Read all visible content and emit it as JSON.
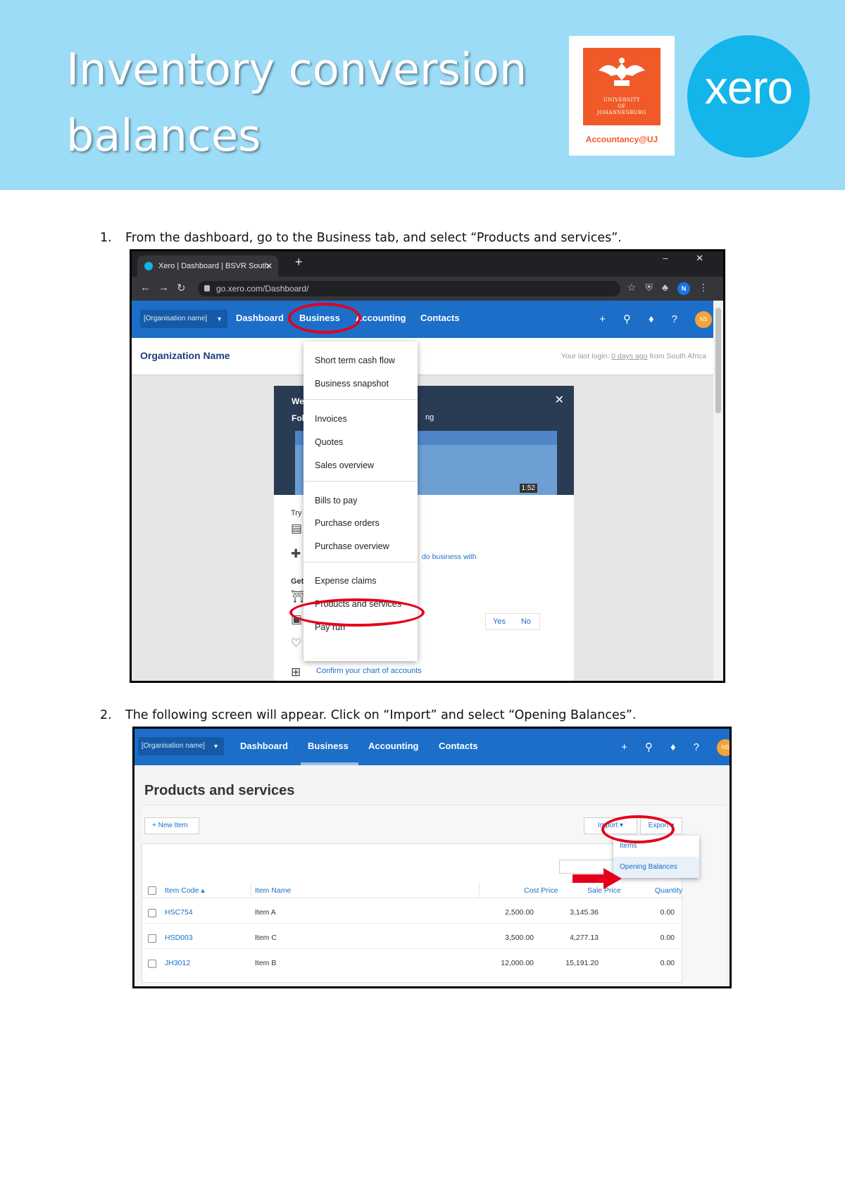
{
  "header": {
    "title_line1": "Inventory conversion",
    "title_line2": "balances",
    "uj_logo": {
      "name_line1": "UNIVERSITY",
      "name_line2": "OF",
      "name_line3": "JOHANNESBURG",
      "caption": "Accountancy@UJ",
      "color": "#f05a28"
    },
    "xero_logo": {
      "word": "xero",
      "color": "#13b5ea"
    },
    "banner_color": "#9ddcf6"
  },
  "steps": [
    {
      "number": "1.",
      "text": "From the dashboard, go to the Business tab, and select “Products and services”."
    },
    {
      "number": "2.",
      "text": "The following screen will appear. Click on “Import” and select “Opening Balances”."
    }
  ],
  "screenshot1": {
    "browser": {
      "tab_title": "Xero | Dashboard | BSVR South …",
      "tab_close": "✕",
      "new_tab": "+",
      "window_controls": "– ✕",
      "url": "go.xero.com/Dashboard/",
      "profile_initial": "N"
    },
    "nav": {
      "org_selector": "[Organisation name]",
      "links": [
        "Dashboard",
        "Business",
        "Accounting",
        "Contacts"
      ],
      "avatar": "NS"
    },
    "org_name": "Organization Name",
    "last_login_prefix": "Your last login: ",
    "last_login_link": "0 days ago",
    "last_login_suffix": " from South Africa",
    "modal": {
      "title_partial": "We",
      "subtitle_partial": "Fol",
      "subtitle_right": "ng",
      "video_duration": "1:52",
      "try_partial": "Try",
      "get_partial": "Get",
      "do_business": "do business with",
      "yes": "Yes",
      "no": "No",
      "confirm_link": "Confirm your chart of accounts"
    },
    "business_menu": [
      "Short term cash flow",
      "Business snapshot",
      "Invoices",
      "Quotes",
      "Sales overview",
      "Bills to pay",
      "Purchase orders",
      "Purchase overview",
      "Expense claims",
      "Products and services",
      "Pay run"
    ]
  },
  "screenshot2": {
    "nav": {
      "org_selector": "[Organisation name]",
      "links": [
        "Dashboard",
        "Business",
        "Accounting",
        "Contacts"
      ],
      "avatar": "NS"
    },
    "page_title": "Products and services",
    "new_item_button": "+ New Item",
    "import_button": "Import ▾",
    "export_button": "Export ▾",
    "import_menu": [
      "Items",
      "Opening Balances"
    ],
    "table": {
      "columns": [
        "Item Code ▴",
        "Item Name",
        "Cost Price",
        "Sale Price",
        "Quantity"
      ],
      "rows": [
        {
          "code": "HSC754",
          "name": "Item A",
          "cost": "2,500.00",
          "sale": "3,145.36",
          "qty": "0.00"
        },
        {
          "code": "HSD003",
          "name": "Item C",
          "cost": "3,500.00",
          "sale": "4,277.13",
          "qty": "0.00"
        },
        {
          "code": "JH3012",
          "name": "Item B",
          "cost": "12,000.00",
          "sale": "15,191.20",
          "qty": "0.00"
        }
      ]
    }
  },
  "colors": {
    "xero_nav": "#1c6ec8",
    "highlight_red": "#e4001b",
    "link_blue": "#1c6ec8"
  }
}
